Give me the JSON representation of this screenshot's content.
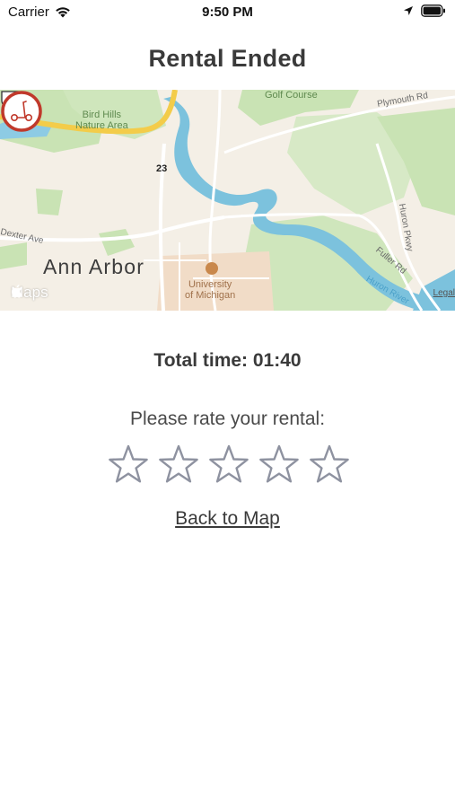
{
  "status_bar": {
    "carrier": "Carrier",
    "time": "9:50 PM"
  },
  "header": {
    "title": "Rental Ended"
  },
  "map": {
    "labels": {
      "golf_course": "Golf Course",
      "plymouth_rd": "Plymouth Rd",
      "bird_hills_line1": "Bird Hills",
      "bird_hills_line2": "Nature Area",
      "route": "23",
      "dexter_ave": "Dexter Ave",
      "huron_pkwy": "Huron Pkwy",
      "fuller_rd": "Fuller Rd",
      "huron_river": "Huron River",
      "city": "Ann Arbor",
      "university_line1": "University",
      "university_line2": "of Michigan"
    },
    "brand": "Maps",
    "legal": "Legal",
    "pin_icon": "scooter-icon",
    "colors": {
      "land": "#f4efe6",
      "park": "#c9e3b4",
      "water": "#7cc2dd",
      "highway": "#f3cc4a",
      "pin": "#c0392b"
    }
  },
  "summary": {
    "total_time": "Total time: 01:40",
    "rate_prompt": "Please rate your rental:",
    "rating": 0,
    "max_rating": 5,
    "star_color": "#8e92a0"
  },
  "actions": {
    "back_to_map": "Back to Map"
  }
}
